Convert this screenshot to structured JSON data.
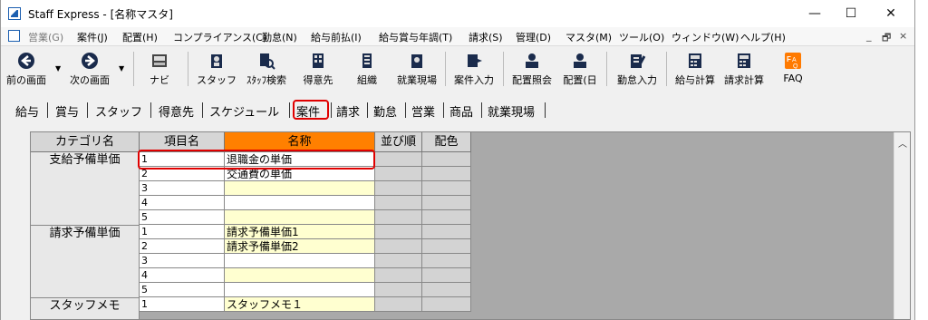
{
  "window": {
    "title": "Staff Express - [名称マスタ]",
    "minimize": "—",
    "maximize": "☐",
    "close": "✕"
  },
  "menu": {
    "items": [
      {
        "label": "営業(G)",
        "disabled": true
      },
      {
        "label": "案件(J)"
      },
      {
        "label": "配置(H)"
      },
      {
        "label": "コンプライアンス(C)"
      },
      {
        "label": "勤怠(N)"
      },
      {
        "label": "給与前払(I)"
      },
      {
        "label": "給与賞与年調(T)"
      },
      {
        "label": "請求(S)"
      },
      {
        "label": "管理(D)"
      },
      {
        "label": "マスタ(M)"
      },
      {
        "label": "ツール(O)"
      },
      {
        "label": "ウィンドウ(W)"
      },
      {
        "label": "ヘルプ(H)"
      }
    ],
    "mdi_min": "_",
    "mdi_restore": "🗗",
    "mdi_close": "×"
  },
  "toolbar": {
    "items": [
      {
        "label": "前の画面",
        "icon": "back-arrow-icon"
      },
      {
        "label": "次の画面",
        "icon": "forward-arrow-icon"
      },
      {
        "label": "ナビ",
        "icon": "keyboard-icon"
      },
      {
        "label": "スタッフ",
        "icon": "staff-icon"
      },
      {
        "label": "ｽﾀｯﾌ検索",
        "icon": "staff-search-icon"
      },
      {
        "label": "得意先",
        "icon": "customer-icon"
      },
      {
        "label": "組織",
        "icon": "organization-icon"
      },
      {
        "label": "就業現場",
        "icon": "worksite-icon"
      },
      {
        "label": "案件入力",
        "icon": "project-input-icon"
      },
      {
        "label": "配置照会",
        "icon": "assignment-inquiry-icon"
      },
      {
        "label": "配置(日",
        "icon": "assignment-daily-icon"
      },
      {
        "label": "勤怠入力",
        "icon": "attendance-input-icon"
      },
      {
        "label": "給与計算",
        "icon": "payroll-icon"
      },
      {
        "label": "請求計算",
        "icon": "billing-icon"
      },
      {
        "label": "FAQ",
        "icon": "faq-icon"
      }
    ]
  },
  "tabs": {
    "items": [
      "給与",
      "賞与",
      "スタッフ",
      "得意先",
      "スケジュール",
      "案件",
      "請求",
      "勤怠",
      "営業",
      "商品",
      "就業現場"
    ],
    "active": "案件"
  },
  "grid": {
    "headers": {
      "category": "カテゴリ名",
      "item": "項目名",
      "name": "名称",
      "order": "並び順",
      "color": "配色"
    },
    "groups": [
      {
        "category": "支給予備単価",
        "rows": [
          {
            "no": "1",
            "name": "退職金の単価"
          },
          {
            "no": "2",
            "name": "交通費の単価"
          },
          {
            "no": "3",
            "name": ""
          },
          {
            "no": "4",
            "name": ""
          },
          {
            "no": "5",
            "name": ""
          }
        ]
      },
      {
        "category": "請求予備単価",
        "rows": [
          {
            "no": "1",
            "name": "請求予備単価1"
          },
          {
            "no": "2",
            "name": "請求予備単価2"
          },
          {
            "no": "3",
            "name": ""
          },
          {
            "no": "4",
            "name": ""
          },
          {
            "no": "5",
            "name": ""
          }
        ]
      },
      {
        "category": "スタッフメモ",
        "rows": [
          {
            "no": "1",
            "name": "スタッフメモ１"
          }
        ]
      }
    ]
  },
  "colors": {
    "accent_header": "#ff8000",
    "highlight": "#e00000",
    "name_cell": "#ffffd0"
  }
}
